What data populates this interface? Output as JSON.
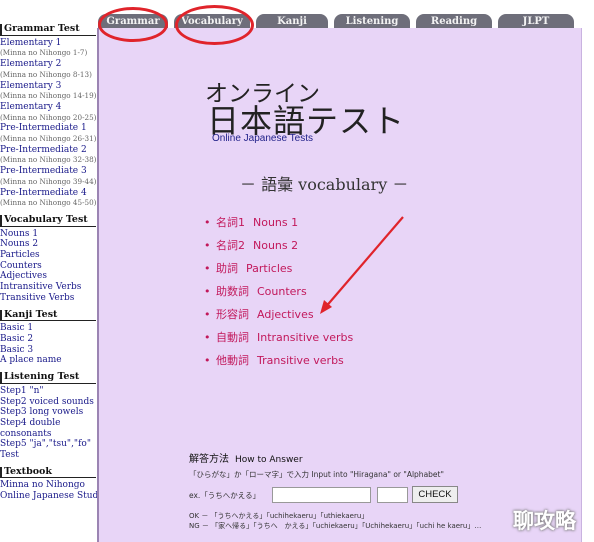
{
  "tabs": [
    "Grammar",
    "Vocabulary",
    "Kanji",
    "Listening",
    "Reading",
    "JLPT"
  ],
  "sidebar": {
    "grammar": {
      "title": "Grammar Test",
      "items": [
        {
          "label": "Elementary 1",
          "sub": "(Minna no Nihongo 1-7)"
        },
        {
          "label": "Elementary 2",
          "sub": "(Minna no Nihongo 8-13)"
        },
        {
          "label": "Elementary 3",
          "sub": "(Minna no Nihongo 14-19)"
        },
        {
          "label": "Elementary 4",
          "sub": "(Minna no Nihongo 20-25)"
        },
        {
          "label": "Pre-Intermediate 1",
          "sub": "(Minna no Nihongo 26-31)"
        },
        {
          "label": "Pre-Intermediate 2",
          "sub": "(Minna no Nihongo 32-38)"
        },
        {
          "label": "Pre-Intermediate 3",
          "sub": "(Minna no Nihongo 39-44)"
        },
        {
          "label": "Pre-Intermediate 4",
          "sub": "(Minna no Nihongo 45-50)"
        }
      ]
    },
    "vocabulary": {
      "title": "Vocabulary Test",
      "items": [
        "Nouns 1",
        "Nouns 2",
        "Particles",
        "Counters",
        "Adjectives",
        "Intransitive Verbs",
        "Transitive Verbs"
      ]
    },
    "kanji": {
      "title": "Kanji Test",
      "items": [
        "Basic 1",
        "Basic 2",
        "Basic 3",
        "A place name"
      ]
    },
    "listening": {
      "title": "Listening Test",
      "items": [
        "Step1 \"n\"",
        "Step2 voiced sounds",
        "Step3 long vowels",
        "Step4 double",
        "consonants",
        "Step5 \"ja\",\"tsu\",\"fo\"",
        "Test"
      ]
    },
    "textbook": {
      "title": "Textbook",
      "items": [
        "Minna no Nihongo",
        "Online Japanese Study"
      ]
    }
  },
  "main": {
    "heading_small": "オンライン",
    "heading_large": "日本語テスト",
    "heading_sub": "Online Japanese Tests",
    "section_title": "－ 語彙 vocabulary －",
    "bullet": "•",
    "menu": [
      {
        "jp": "名詞1",
        "en": "Nouns 1"
      },
      {
        "jp": "名詞2",
        "en": "Nouns 2"
      },
      {
        "jp": "助詞",
        "en": "Particles"
      },
      {
        "jp": "助数詞",
        "en": "Counters"
      },
      {
        "jp": "形容詞",
        "en": "Adjectives"
      },
      {
        "jp": "自動詞",
        "en": "Intransitive verbs"
      },
      {
        "jp": "他動詞",
        "en": "Transitive verbs"
      }
    ],
    "answer": {
      "title_jp": "解答方法",
      "title_en": "How to Answer",
      "note": "「ひらがな」か「ローマ字」で入力 Input into \"Hiragana\" or \"Alphabet\"",
      "example_label": "ex.「うちへかえる」",
      "check_label": "CHECK",
      "ok_line": "OK － 「うちへかえる」「uchihekaeru」「uthiekaeru」",
      "ng_line": "NG － 「家へ帰る」「うちへ　かえる」「uchiekaeru」「Uchihekaeru」「uchi he kaeru」…"
    }
  },
  "watermark": "聊攻略",
  "annotation_color": "#e0242b"
}
